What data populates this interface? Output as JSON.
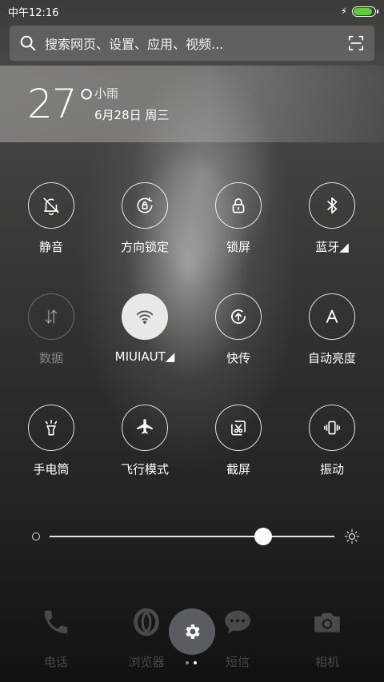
{
  "status_bar": {
    "time": "中午12:16",
    "battery_color": "#55d22b",
    "battery_level": 0.9
  },
  "search": {
    "placeholder": "搜索网页、设置、应用、视频..."
  },
  "weather": {
    "temperature": "27°",
    "condition": "小雨",
    "date": "6月28日 周三"
  },
  "toggles": [
    {
      "label": "静音",
      "icon": "bell-off-icon",
      "state": "on"
    },
    {
      "label": "方向锁定",
      "icon": "rotation-lock-icon",
      "state": "on"
    },
    {
      "label": "锁屏",
      "icon": "lock-icon",
      "state": "on"
    },
    {
      "label": "蓝牙◢",
      "icon": "bluetooth-icon",
      "state": "on"
    },
    {
      "label": "数据",
      "icon": "data-arrows-icon",
      "state": "off"
    },
    {
      "label": "MIUIAUT◢",
      "icon": "wifi-icon",
      "state": "active"
    },
    {
      "label": "快传",
      "icon": "share-upload-icon",
      "state": "on"
    },
    {
      "label": "自动亮度",
      "icon": "auto-brightness-icon",
      "state": "on"
    },
    {
      "label": "手电筒",
      "icon": "flashlight-icon",
      "state": "on"
    },
    {
      "label": "飞行模式",
      "icon": "airplane-icon",
      "state": "on"
    },
    {
      "label": "截屏",
      "icon": "screenshot-icon",
      "state": "on"
    },
    {
      "label": "振动",
      "icon": "vibrate-icon",
      "state": "on"
    }
  ],
  "brightness": {
    "level": 0.75
  },
  "dock": [
    {
      "label": "电话",
      "icon": "phone-icon"
    },
    {
      "label": "浏览器",
      "icon": "browser-icon"
    },
    {
      "label": "短信",
      "icon": "message-icon"
    },
    {
      "label": "相机",
      "icon": "camera-icon"
    }
  ],
  "fab": {
    "icon": "gear-icon"
  }
}
